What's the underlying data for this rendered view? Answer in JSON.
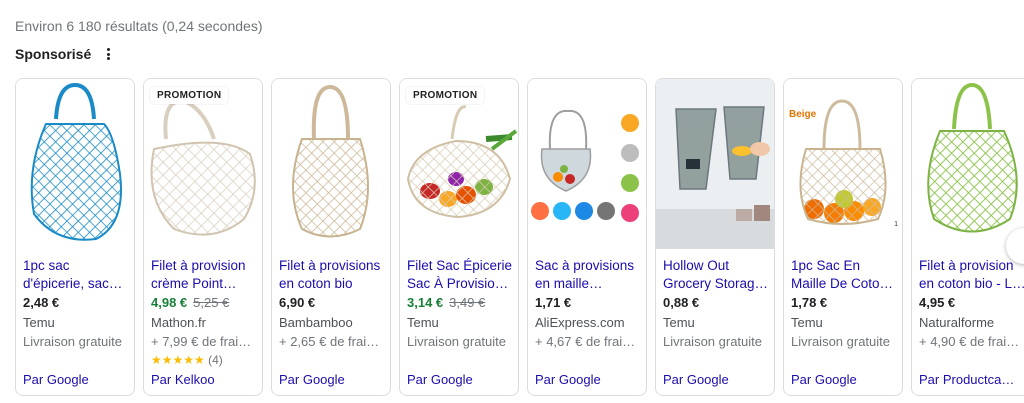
{
  "results_stats": "Environ 6 180 résultats (0,24 secondes)",
  "sponsored_label": "Sponsorisé",
  "colors": {
    "link": "#1a0dab",
    "sale_price": "#188038",
    "star": "#fbbc04",
    "badge_beige": "#e37400"
  },
  "products": [
    {
      "image": "blue-mesh-bag",
      "title_line1": "1pc sac",
      "title_line2": "d'épicerie, sac…",
      "price": "2,48 €",
      "merchant": "Temu",
      "shipping": "Livraison gratuite",
      "byline": "Par Google"
    },
    {
      "badge": "PROMOTION",
      "image": "cream-mesh-bag",
      "title_line1": "Filet à provision",
      "title_line2": "crème Point…",
      "price": "4,98 €",
      "old_price": "5,25 €",
      "merchant": "Mathon.fr",
      "shipping": "+ 7,99 € de frai…",
      "stars": "★★★★★",
      "rating": 5,
      "rating_count": "(4)",
      "byline": "Par Kelkoo"
    },
    {
      "image": "cotton-mesh-bag",
      "title_line1": "Filet à provisions",
      "title_line2": "en coton bio",
      "price": "6,90 €",
      "merchant": "Bambamboo",
      "shipping": "+ 2,65 € de frai…",
      "byline": "Par Google"
    },
    {
      "badge": "PROMOTION",
      "image": "bag-with-vegetables",
      "title_line1": "Filet Sac Épicerie",
      "title_line2": "Sac À Provisio…",
      "price": "3,14 €",
      "old_price": "3,49 €",
      "merchant": "Temu",
      "shipping": "Livraison gratuite",
      "byline": "Par Google"
    },
    {
      "image": "multicolor-mesh-bags",
      "title_line1": "Sac à provisions",
      "title_line2": "en maille…",
      "price": "1,71 €",
      "merchant": "AliExpress.com",
      "shipping": "+ 4,67 € de frai…",
      "byline": "Par Google"
    },
    {
      "image": "hanging-storage-bags",
      "title_line1": "Hollow Out",
      "title_line2": "Grocery Storag…",
      "price": "0,88 €",
      "merchant": "Temu",
      "shipping": "Livraison gratuite",
      "byline": "Par Google"
    },
    {
      "image": "beige-bag-oranges",
      "tag": "Beige",
      "corner_mark": "1",
      "title_line1": "1pc Sac En",
      "title_line2": "Maille De Coto…",
      "price": "1,78 €",
      "merchant": "Temu",
      "shipping": "Livraison gratuite",
      "byline": "Par Google"
    },
    {
      "image": "green-mesh-bag",
      "title_line1": "Filet à provision",
      "title_line2": "en coton bio - L…",
      "price": "4,95 €",
      "merchant": "Naturalforme",
      "shipping": "+ 4,90 € de frai…",
      "byline": "Par Productca…"
    }
  ]
}
